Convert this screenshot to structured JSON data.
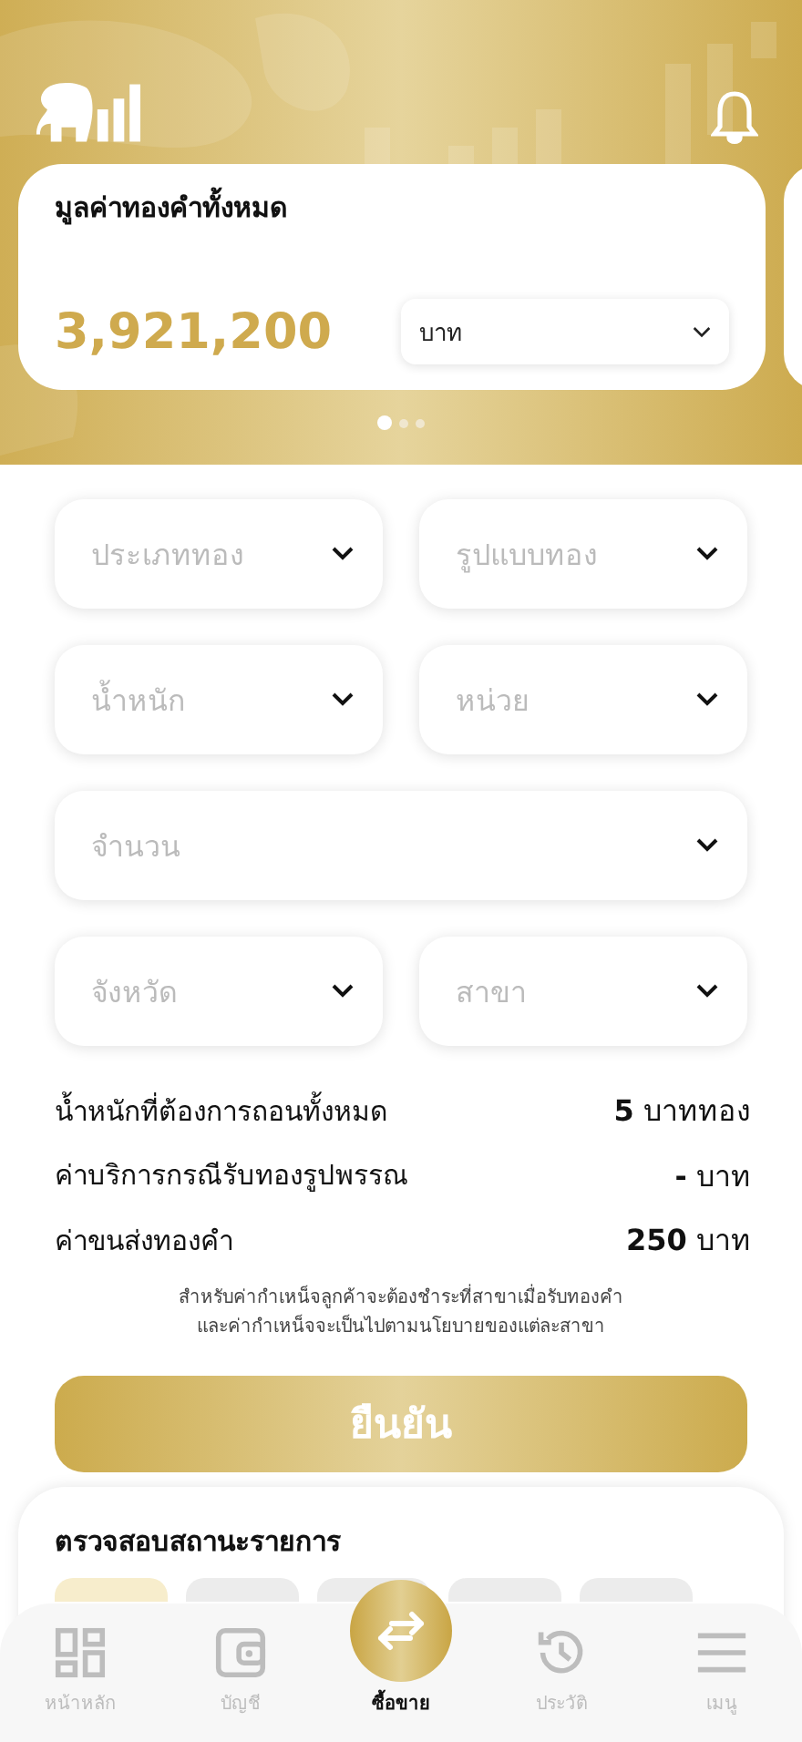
{
  "value_card": {
    "title": "มูลค่าทองคำทั้งหมด",
    "amount": "3,921,200",
    "unit_select": {
      "value": "บาท"
    }
  },
  "carousel_dots": [
    {
      "selected": true
    },
    {
      "selected": false
    },
    {
      "selected": false
    }
  ],
  "form_fields": [
    {
      "placeholder": "ประเภททอง",
      "wide": false
    },
    {
      "placeholder": "รูปแบบทอง",
      "wide": false
    },
    {
      "placeholder": "น้ำหนัก",
      "wide": false
    },
    {
      "placeholder": "หน่วย",
      "wide": false
    },
    {
      "placeholder": "จำนวน",
      "wide": true
    },
    {
      "placeholder": "จังหวัด",
      "wide": false
    },
    {
      "placeholder": "สาขา",
      "wide": false
    }
  ],
  "summary": [
    {
      "label": "น้ำหนักที่ต้องการถอนทั้งหมด",
      "value": "5",
      "unit": "บาททอง"
    },
    {
      "label": "ค่าบริการกรณีรับทองรูปพรรณ",
      "value": "-",
      "unit": "บาท"
    },
    {
      "label": "ค่าขนส่งทองคำ",
      "value": "250",
      "unit": "บาท"
    }
  ],
  "note": [
    "สำหรับค่ากำเหน็จลูกค้าจะต้องชำระที่สาขาเมื่อรับทองคำ",
    "และค่ากำเหน็จจะเป็นไปตามนโยบายของแต่ละสาขา"
  ],
  "confirm_button": "ยืนยัน",
  "status_section": {
    "title": "ตรวจสอบสถานะรายการ",
    "chips": [
      {
        "selected": true
      },
      {
        "selected": false
      },
      {
        "selected": false
      },
      {
        "selected": false
      },
      {
        "selected": false
      }
    ]
  },
  "bottom_nav": [
    {
      "kind": "home",
      "label": "หน้าหลัก",
      "selected": false
    },
    {
      "kind": "wallet",
      "label": "บัญชี",
      "selected": false
    },
    {
      "kind": "exchange",
      "label": "ซื้อขาย",
      "selected": true
    },
    {
      "kind": "history",
      "label": "ประวัติ",
      "selected": false
    },
    {
      "kind": "menu",
      "label": "เมนู",
      "selected": false
    }
  ]
}
